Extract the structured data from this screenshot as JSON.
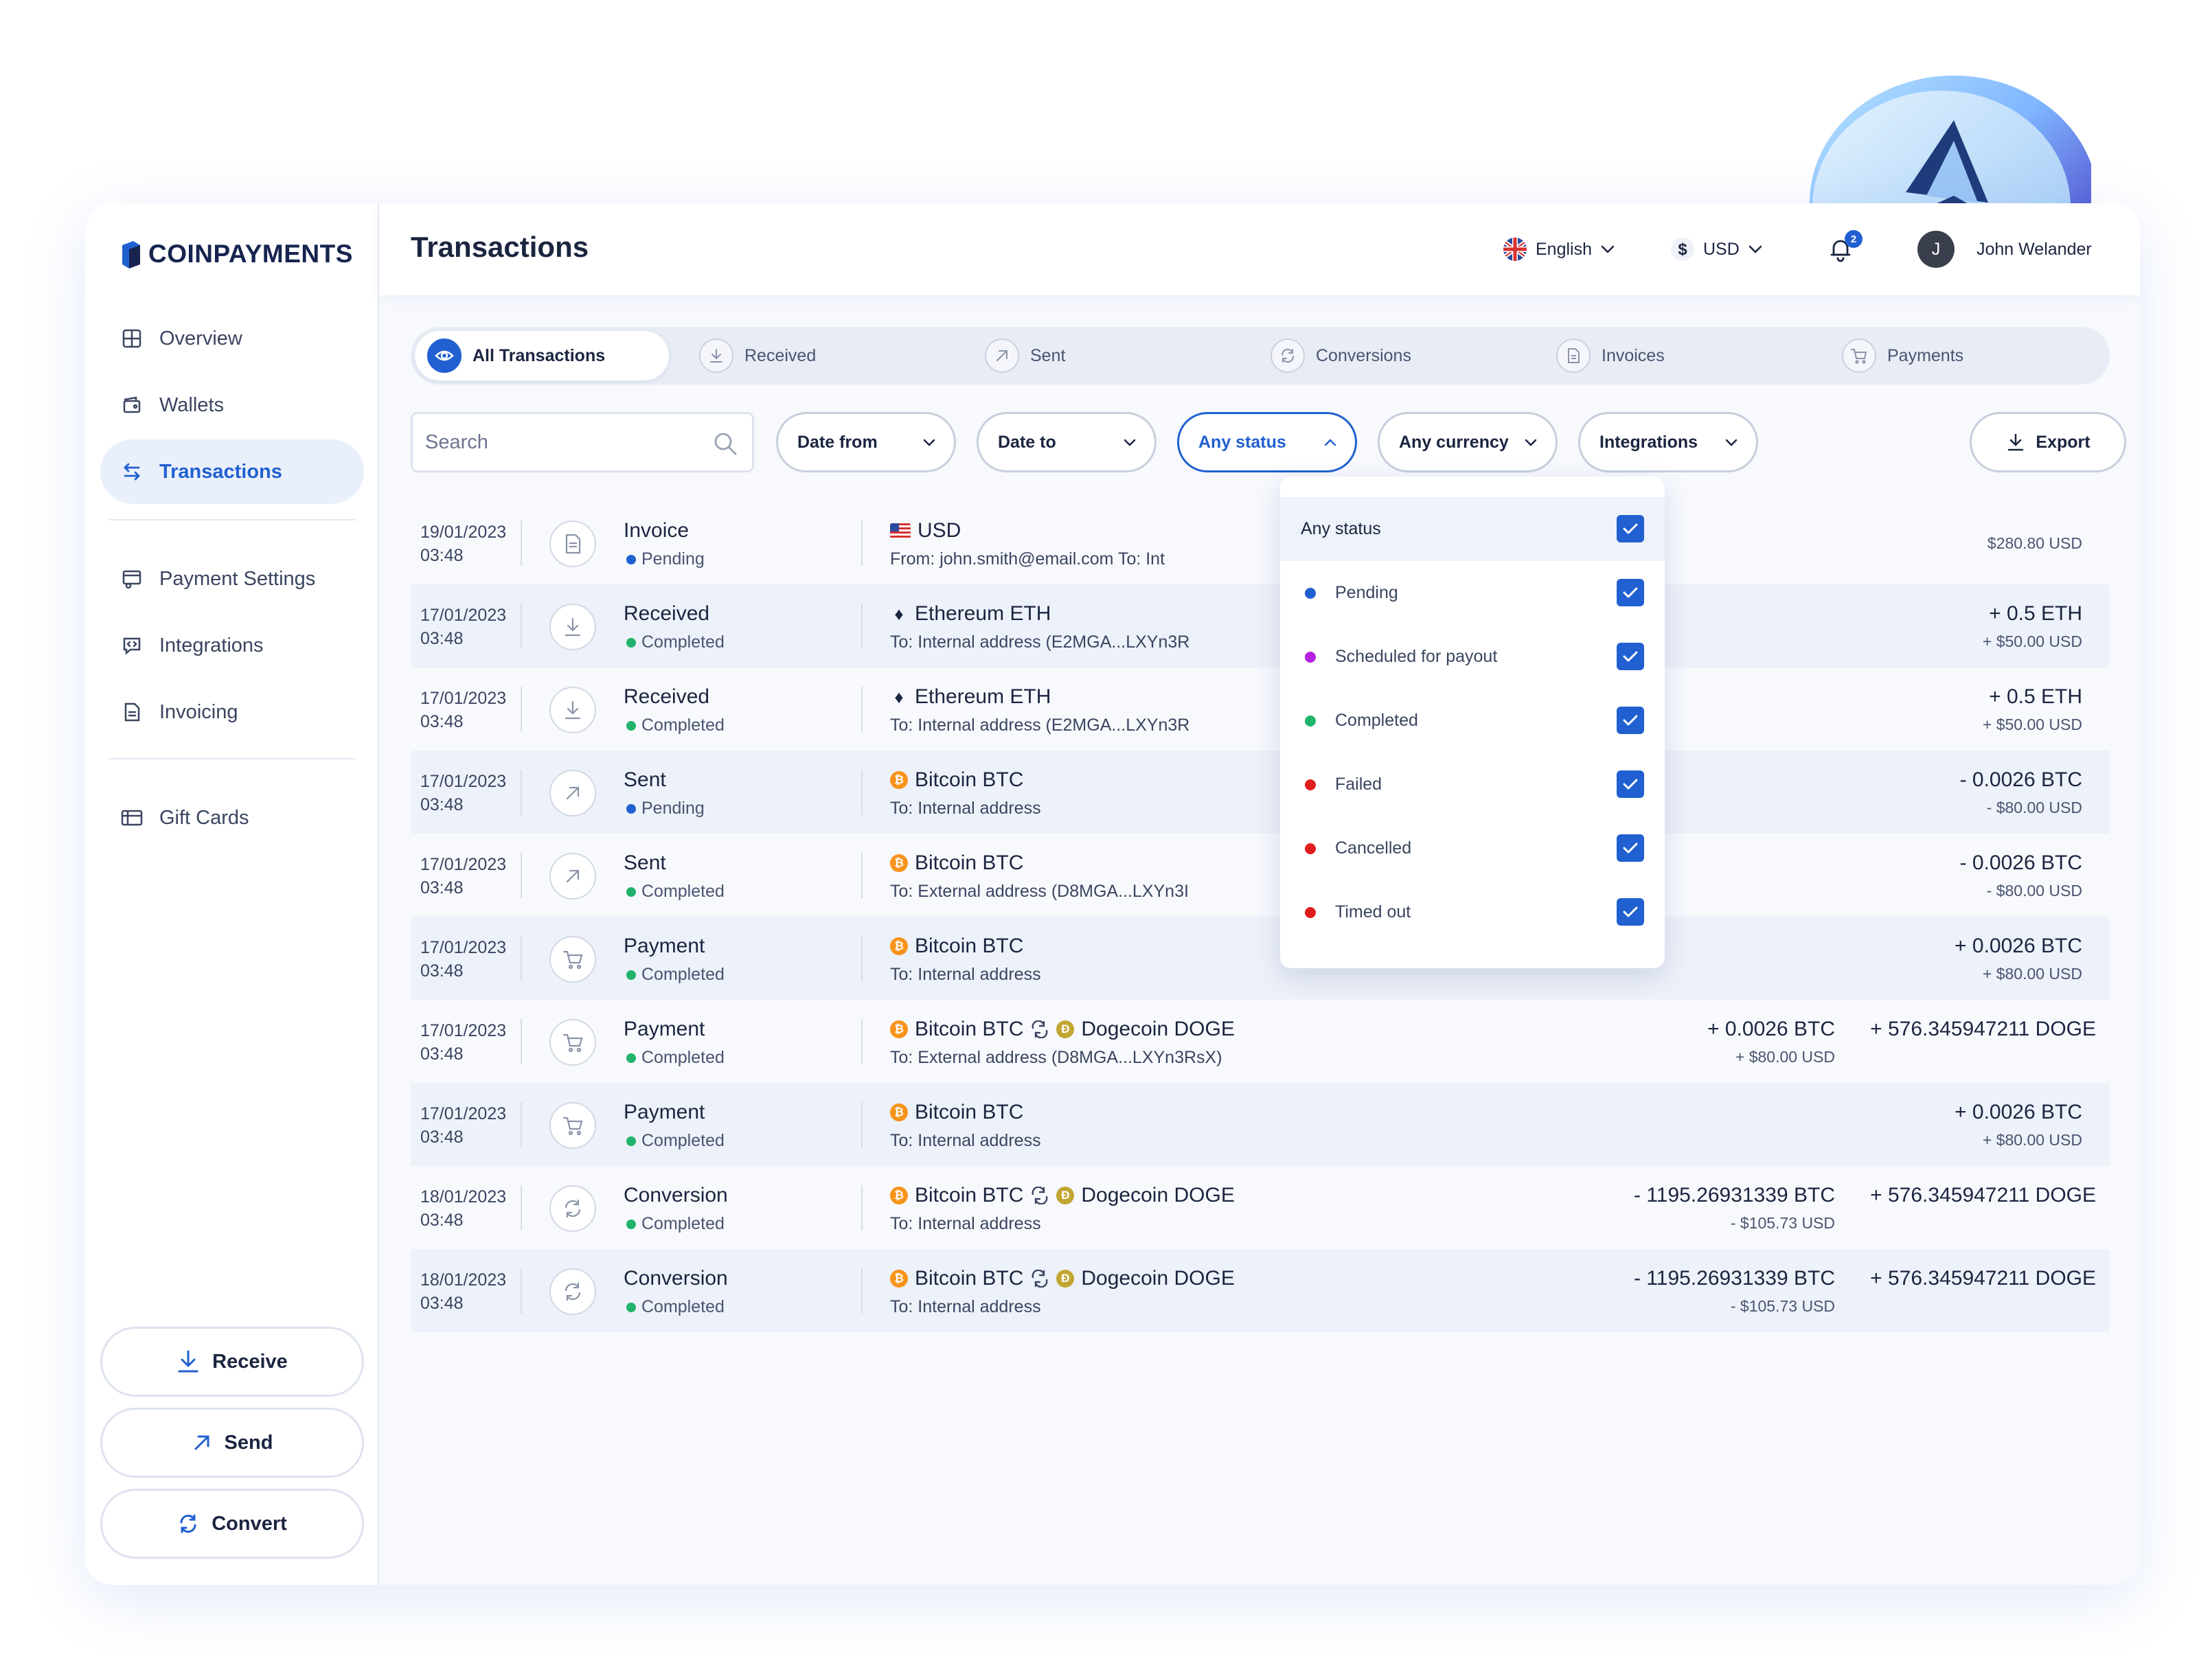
{
  "brand": {
    "name": "COINPAYMENTS"
  },
  "sidebar": {
    "items": [
      {
        "label": "Overview",
        "icon": "grid-icon"
      },
      {
        "label": "Wallets",
        "icon": "wallet-icon"
      },
      {
        "label": "Transactions",
        "icon": "transfer-icon",
        "active": true
      },
      {
        "label": "Payment Settings",
        "icon": "payment-settings-icon"
      },
      {
        "label": "Integrations",
        "icon": "integrations-icon"
      },
      {
        "label": "Invoicing",
        "icon": "invoice-icon"
      },
      {
        "label": "Gift Cards",
        "icon": "gift-card-icon"
      }
    ],
    "actions": {
      "receive": "Receive",
      "send": "Send",
      "convert": "Convert"
    }
  },
  "header": {
    "title": "Transactions",
    "language": "English",
    "currency": "USD",
    "notifications": "2",
    "user_initial": "J",
    "user_name": "John Welander"
  },
  "tabs": [
    {
      "label": "All Transactions",
      "active": true
    },
    {
      "label": "Received"
    },
    {
      "label": "Sent"
    },
    {
      "label": "Conversions"
    },
    {
      "label": "Invoices"
    },
    {
      "label": "Payments"
    }
  ],
  "filters": {
    "search_placeholder": "Search",
    "date_from": "Date from",
    "date_to": "Date to",
    "status": "Any status",
    "currency": "Any currency",
    "integrations": "Integrations",
    "export": "Export"
  },
  "status_dropdown": {
    "items": [
      {
        "label": "Any status",
        "checked": true
      },
      {
        "label": "Pending",
        "color": "#2160d0",
        "checked": true
      },
      {
        "label": "Scheduled for payout",
        "color": "#b620e0",
        "checked": true
      },
      {
        "label": "Completed",
        "color": "#21b36b",
        "checked": true
      },
      {
        "label": "Failed",
        "color": "#e01e1e",
        "checked": true
      },
      {
        "label": "Cancelled",
        "color": "#e01e1e",
        "checked": true
      },
      {
        "label": "Timed out",
        "color": "#e01e1e",
        "checked": true
      }
    ]
  },
  "status_colors": {
    "Pending": "#2160d0",
    "Completed": "#21b36b"
  },
  "transactions": [
    {
      "date": "19/01/2023",
      "time": "03:48",
      "type": "Invoice",
      "status": "Pending",
      "currency": "USD",
      "address": "From: john.smith@email.com  To: Int",
      "amount": "",
      "amount_usd": "$280.80 USD"
    },
    {
      "date": "17/01/2023",
      "time": "03:48",
      "type": "Received",
      "status": "Completed",
      "currency": "Ethereum ETH",
      "address": "To: Internal address (E2MGA...LXYn3R",
      "amount": "+ 0.5 ETH",
      "amount_usd": "+ $50.00 USD"
    },
    {
      "date": "17/01/2023",
      "time": "03:48",
      "type": "Received",
      "status": "Completed",
      "currency": "Ethereum ETH",
      "address": "To: Internal address (E2MGA...LXYn3R",
      "amount": "+ 0.5 ETH",
      "amount_usd": "+ $50.00 USD"
    },
    {
      "date": "17/01/2023",
      "time": "03:48",
      "type": "Sent",
      "status": "Pending",
      "currency": "Bitcoin BTC",
      "address": "To: Internal address",
      "amount": "- 0.0026 BTC",
      "amount_usd": "- $80.00 USD"
    },
    {
      "date": "17/01/2023",
      "time": "03:48",
      "type": "Sent",
      "status": "Completed",
      "currency": "Bitcoin BTC",
      "address": "To: External address (D8MGA...LXYn3I",
      "amount": "- 0.0026 BTC",
      "amount_usd": "- $80.00 USD"
    },
    {
      "date": "17/01/2023",
      "time": "03:48",
      "type": "Payment",
      "status": "Completed",
      "currency": "Bitcoin BTC",
      "address": "To: Internal address",
      "amount": "+ 0.0026 BTC",
      "amount_usd": "+ $80.00 USD"
    },
    {
      "date": "17/01/2023",
      "time": "03:48",
      "type": "Payment",
      "status": "Completed",
      "currency": "Bitcoin BTC",
      "currency_to": "Dogecoin DOGE",
      "address": "To: External address (D8MGA...LXYn3RsX)",
      "amount": "+ 0.0026 BTC",
      "amount_usd": "+ $80.00 USD",
      "amount_to": "+ 576.345947211 DOGE"
    },
    {
      "date": "17/01/2023",
      "time": "03:48",
      "type": "Payment",
      "status": "Completed",
      "currency": "Bitcoin BTC",
      "address": "To: Internal address",
      "amount": "+ 0.0026 BTC",
      "amount_usd": "+ $80.00 USD"
    },
    {
      "date": "18/01/2023",
      "time": "03:48",
      "type": "Conversion",
      "status": "Completed",
      "currency": "Bitcoin BTC",
      "currency_to": "Dogecoin DOGE",
      "address": "To: Internal address",
      "amount": "- 1195.26931339 BTC",
      "amount_usd": "- $105.73 USD",
      "amount_to": "+ 576.345947211 DOGE"
    },
    {
      "date": "18/01/2023",
      "time": "03:48",
      "type": "Conversion",
      "status": "Completed",
      "currency": "Bitcoin BTC",
      "currency_to": "Dogecoin DOGE",
      "address": "To: Internal  address",
      "amount": "- 1195.26931339 BTC",
      "amount_usd": "- $105.73 USD",
      "amount_to": "+ 576.345947211 DOGE"
    }
  ]
}
